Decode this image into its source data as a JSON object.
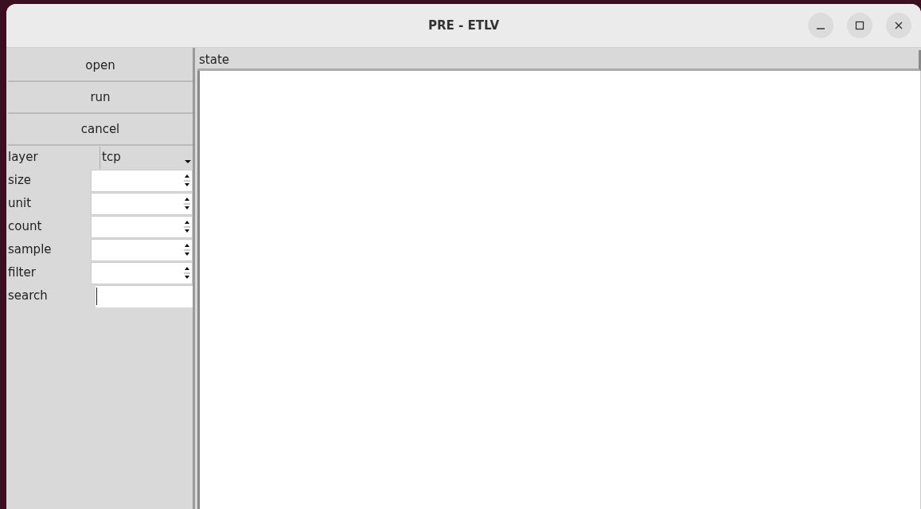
{
  "window": {
    "title": "PRE - ETLV"
  },
  "buttons": [
    "open",
    "run",
    "cancel"
  ],
  "controls": [
    {
      "kind": "select",
      "label": "layer",
      "value": "tcp"
    },
    {
      "kind": "spinbox",
      "label": "size"
    },
    {
      "kind": "spinbox",
      "label": "unit"
    },
    {
      "kind": "spinbox",
      "label": "count"
    },
    {
      "kind": "spinbox",
      "label": "sample"
    },
    {
      "kind": "spinbox",
      "label": "filter"
    },
    {
      "kind": "entry",
      "label": "search"
    }
  ],
  "list": {
    "header": "state"
  }
}
